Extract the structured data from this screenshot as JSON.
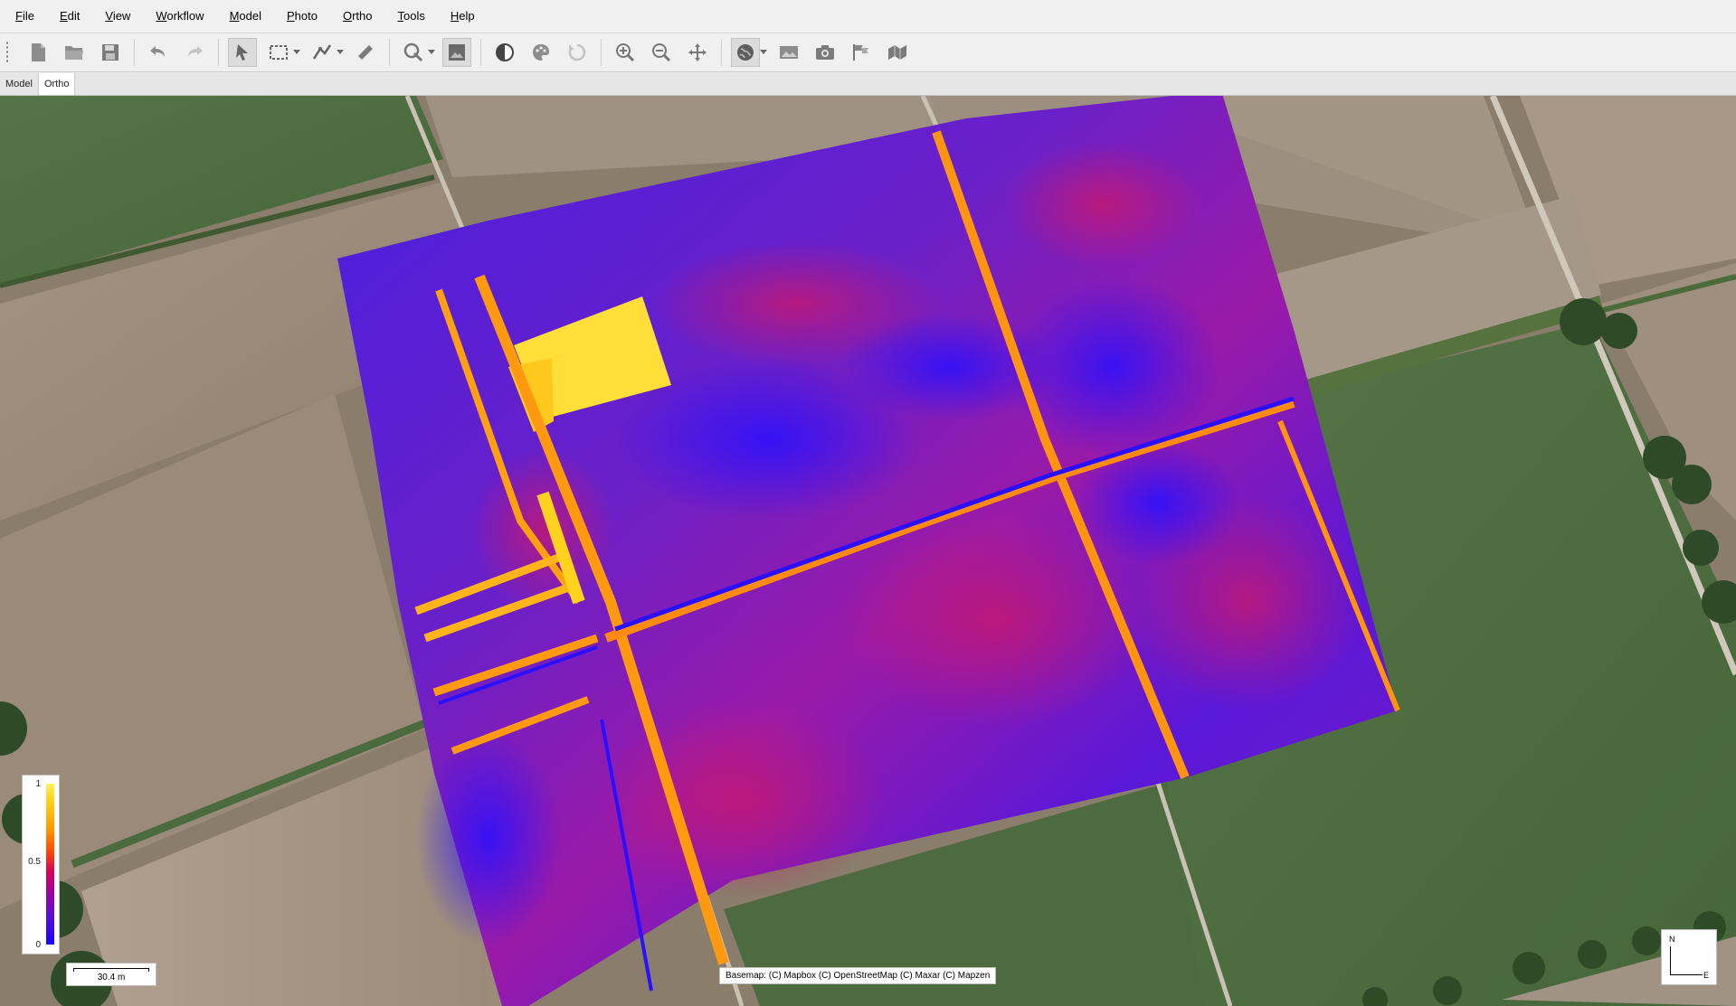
{
  "menu": [
    {
      "mnemonic": "F",
      "rest": "ile"
    },
    {
      "mnemonic": "E",
      "rest": "dit"
    },
    {
      "mnemonic": "V",
      "rest": "iew"
    },
    {
      "mnemonic": "W",
      "rest": "orkflow"
    },
    {
      "mnemonic": "M",
      "rest": "odel"
    },
    {
      "mnemonic": "P",
      "rest": "hoto"
    },
    {
      "mnemonic": "O",
      "rest": "rtho"
    },
    {
      "mnemonic": "T",
      "rest": "ools"
    },
    {
      "mnemonic": "H",
      "rest": "elp"
    }
  ],
  "toolbar": {
    "icons": [
      "new-document-icon",
      "open-folder-icon",
      "save-icon",
      "undo-icon",
      "redo-icon",
      "select-arrow-icon",
      "rectangle-selection-icon",
      "polyline-icon",
      "ruler-icon",
      "draw-shape-icon",
      "orthophoto-icon",
      "contrast-icon",
      "palette-icon",
      "reset-view-icon",
      "zoom-in-icon",
      "zoom-out-icon",
      "move-icon",
      "basemap-globe-icon",
      "image-icon",
      "camera-icon",
      "marker-flags-icon",
      "shapes-icon"
    ]
  },
  "tabs": [
    {
      "label": "Model",
      "active": false
    },
    {
      "label": "Ortho",
      "active": true
    }
  ],
  "legend": {
    "max": "1",
    "mid": "0.5",
    "min": "0",
    "palette": [
      "#1a00ff",
      "#9c00a0",
      "#ff4a00",
      "#ffd21e",
      "#fff25a"
    ]
  },
  "scale_bar": {
    "label": "30.4 m"
  },
  "basemap_credits": "Basemap: (C) Mapbox (C) OpenStreetMap (C) Maxar (C) Mapzen",
  "compass": {
    "north": "N",
    "east": "E"
  },
  "colors": {
    "field_green": "#4f6c3f",
    "field_brown": "#9c8b79",
    "index_low": "#2a10e8",
    "index_high": "#ffd21e"
  }
}
